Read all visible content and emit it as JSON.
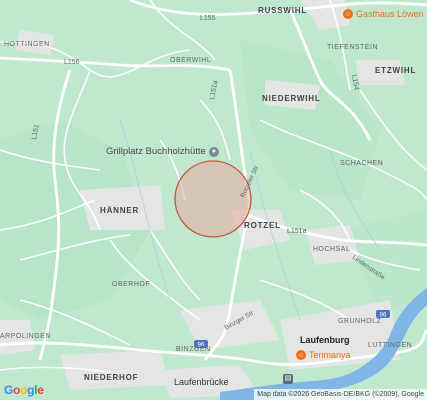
{
  "map": {
    "attribution": "Map data ©2026 GeoBasis-DE/BKG (©2009), Google",
    "logo": "Google",
    "colors": {
      "land": "#bfe8cf",
      "water": "#7fb6e6",
      "road": "#ffffff",
      "circle_fill": "#e8a8a0",
      "circle_stroke": "#c8553a"
    }
  },
  "places": {
    "russwihl": "RUSSWIHL",
    "hottingen": "HOTTINGEN",
    "oberwihl": "OBERWIHL",
    "tiefenstein": "TIEFENSTEIN",
    "etzwihl": "ETZWIHL",
    "niederwihl": "NIEDERWIHL",
    "schachen": "SCHACHEN",
    "hanner": "HÄNNER",
    "rotzel": "ROTZEL",
    "hochsal": "HOCHSAL",
    "oberhof": "OBERHOF",
    "grunholz": "GRUNHOLZ",
    "luttingen": "LUTTINGEN",
    "binzgen": "BINZGEN",
    "niederhof": "NIEDERHOF",
    "carpolingen": "ARPOLINGEN",
    "laufenburg": "Laufenburg",
    "laufenbrucke": "Laufenbrücke"
  },
  "roads": {
    "l155": "L155",
    "l156": "L156",
    "l151a_top": "L151a",
    "l151a_mid": "L151a",
    "l151": "L151",
    "l154a": "L154",
    "rotzeler": "Rotzeler Str",
    "lindenstrasse": "Lindenstraße",
    "binzger": "Binzger Str",
    "r96_a": "96",
    "r96_b": "96"
  },
  "pois": {
    "gasthaus": "Gasthaus Löwen",
    "grillplatz": "Grillplatz Buchholzhütte",
    "tenmanya": "Tenmanya"
  }
}
